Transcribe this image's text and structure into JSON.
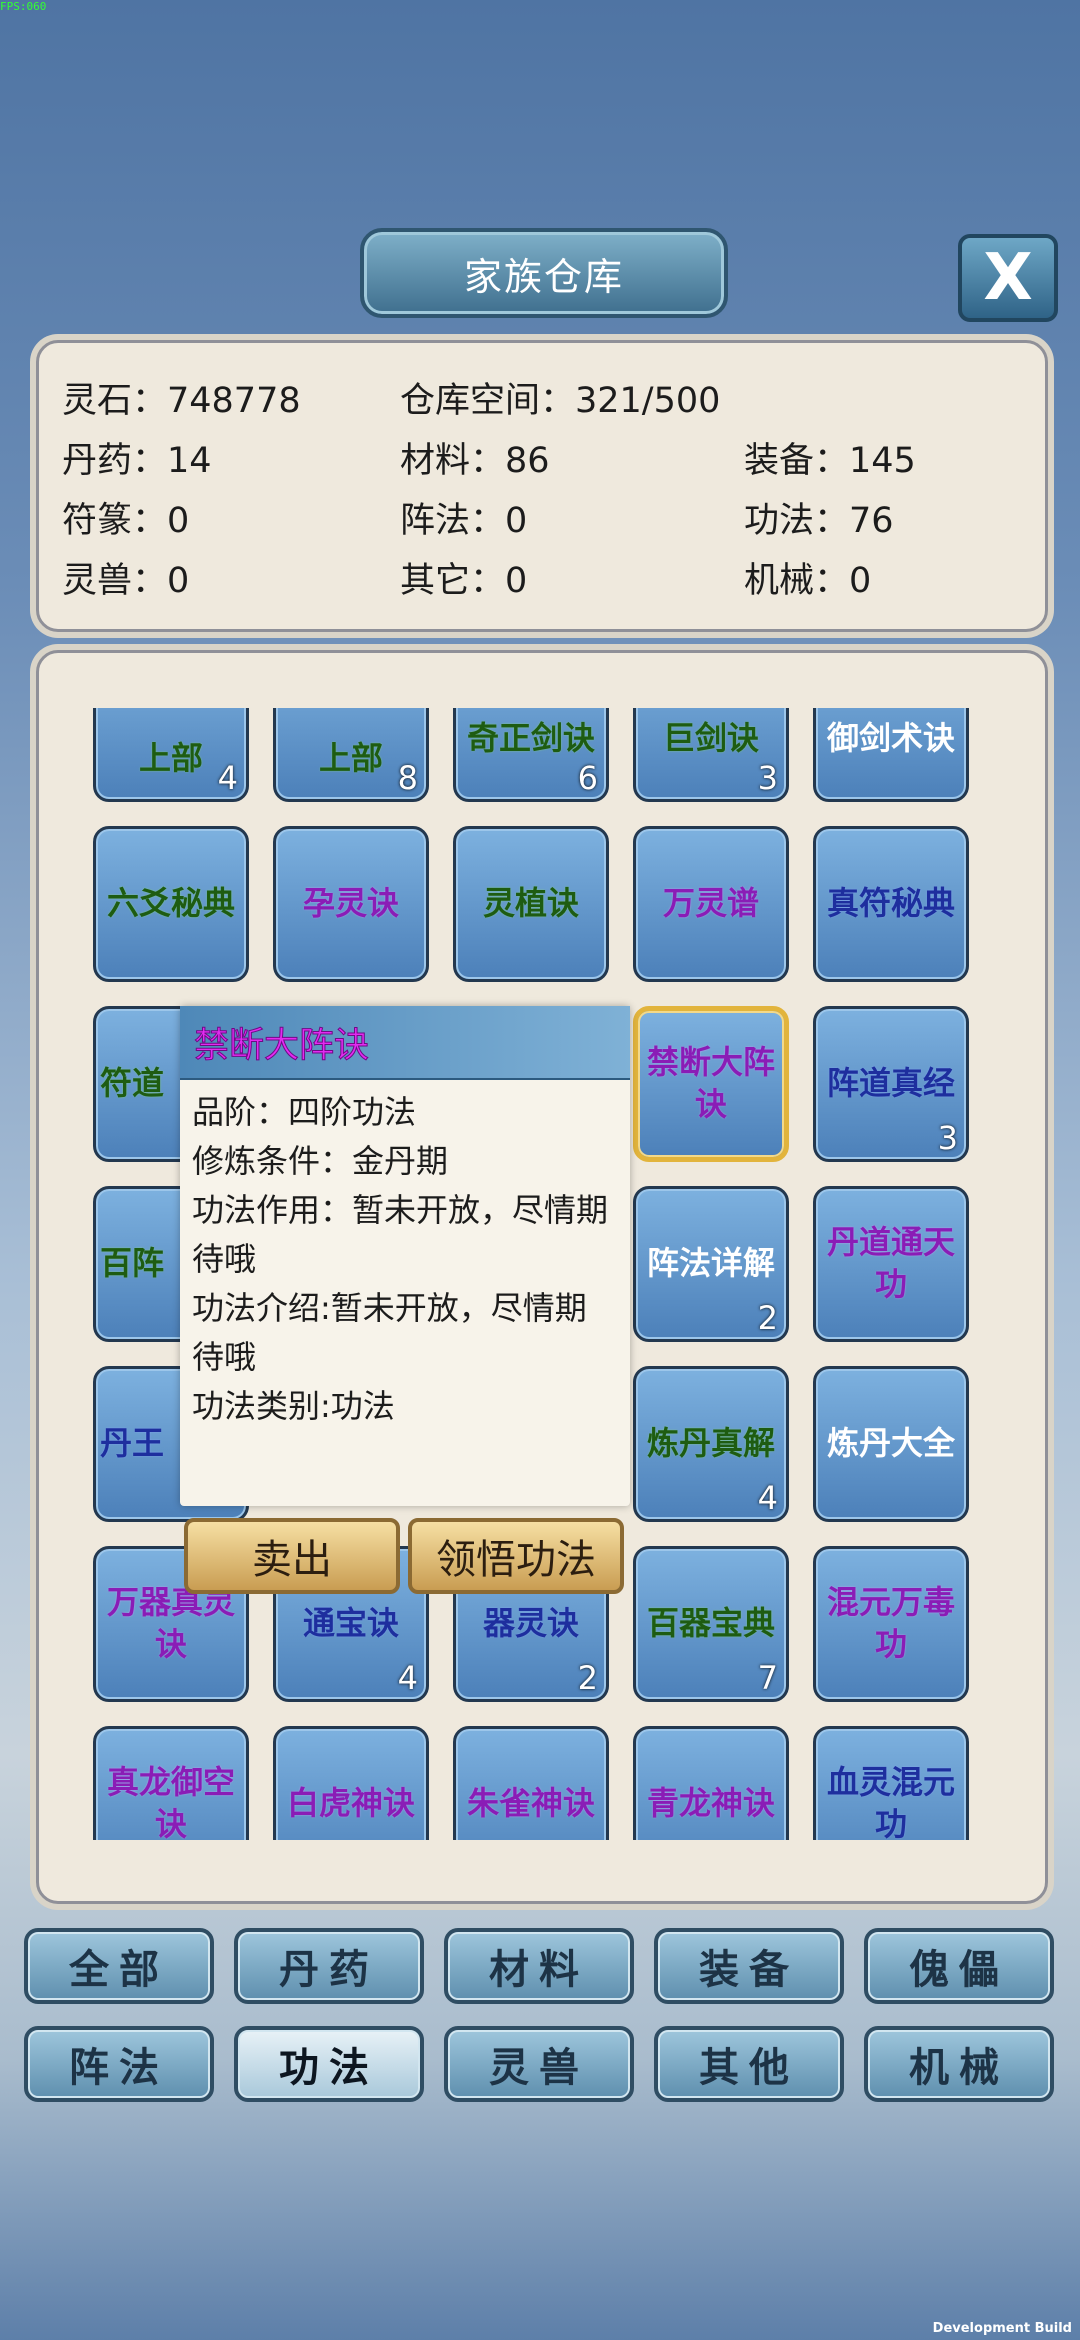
{
  "debug": {
    "fps": "FPS:060",
    "build": "Development Build"
  },
  "header": {
    "title": "家族仓库",
    "close_label": "X"
  },
  "stats": {
    "spirit_stone": "灵石：748778",
    "storage": "仓库空间：321/500",
    "pills": "丹药：14",
    "materials": "材料：86",
    "equipment": "装备：145",
    "talismans": "符篆：0",
    "formations": "阵法：0",
    "techniques": "功法：76",
    "beasts": "灵兽：0",
    "others": "其它：0",
    "machines": "机械：0"
  },
  "grid": {
    "row0": [
      {
        "name": "上部",
        "count": "4",
        "color": "g"
      },
      {
        "name": "上部",
        "count": "8",
        "color": "g"
      },
      {
        "name": "奇正剑诀",
        "count": "6",
        "color": "g"
      },
      {
        "name": "巨剑诀",
        "count": "3",
        "color": "g"
      },
      {
        "name": "御剑术诀",
        "count": "",
        "color": "w"
      }
    ],
    "row1": [
      {
        "name": "六爻秘典",
        "count": "",
        "color": "g"
      },
      {
        "name": "孕灵诀",
        "count": "",
        "color": "p"
      },
      {
        "name": "灵植诀",
        "count": "",
        "color": "g"
      },
      {
        "name": "万灵谱",
        "count": "",
        "color": "p"
      },
      {
        "name": "真符秘典",
        "count": "",
        "color": "b"
      }
    ],
    "row2": [
      {
        "name": "符道",
        "count": "",
        "color": "g"
      },
      {
        "name": "禁断大阵诀",
        "count": "",
        "color": "p"
      },
      {
        "name": "阵道真经",
        "count": "3",
        "color": "b"
      }
    ],
    "row3": [
      {
        "name": "百阵",
        "count": "",
        "color": "g"
      },
      {
        "name": "阵法详解",
        "count": "2",
        "color": "w"
      },
      {
        "name": "丹道通天功",
        "count": "",
        "color": "p"
      }
    ],
    "row4": [
      {
        "name": "丹王",
        "count": "",
        "color": "b"
      },
      {
        "name": "炼丹真解",
        "count": "4",
        "color": "g"
      },
      {
        "name": "炼丹大全",
        "count": "",
        "color": "w"
      }
    ],
    "row5": [
      {
        "name": "万器真灵诀",
        "count": "",
        "color": "p"
      },
      {
        "name": "通宝诀",
        "count": "4",
        "color": "b"
      },
      {
        "name": "器灵诀",
        "count": "2",
        "color": "b"
      },
      {
        "name": "百器宝典",
        "count": "7",
        "color": "g"
      },
      {
        "name": "混元万毒功",
        "count": "",
        "color": "p"
      }
    ],
    "row6": [
      {
        "name": "真龙御空诀",
        "count": "",
        "color": "p"
      },
      {
        "name": "白虎神诀",
        "count": "",
        "color": "p"
      },
      {
        "name": "朱雀神诀",
        "count": "",
        "color": "p"
      },
      {
        "name": "青龙神诀",
        "count": "",
        "color": "p"
      },
      {
        "name": "血灵混元功",
        "count": "",
        "color": "b"
      }
    ]
  },
  "popup": {
    "title": "禁断大阵诀",
    "grade": "品阶：四阶功法",
    "requirement": "修炼条件：金丹期",
    "effect": "功法作用：暂未开放，尽情期待哦",
    "intro": "功法介绍:暂未开放，尽情期待哦",
    "category": "功法类别:功法"
  },
  "actions": {
    "sell": "卖出",
    "learn": "领悟功法"
  },
  "tabs": [
    {
      "label": "全部"
    },
    {
      "label": "丹药"
    },
    {
      "label": "材料"
    },
    {
      "label": "装备"
    },
    {
      "label": "傀儡"
    },
    {
      "label": "阵法"
    },
    {
      "label": "功法"
    },
    {
      "label": "灵兽"
    },
    {
      "label": "其他"
    },
    {
      "label": "机械"
    }
  ],
  "active_tab": "功法"
}
